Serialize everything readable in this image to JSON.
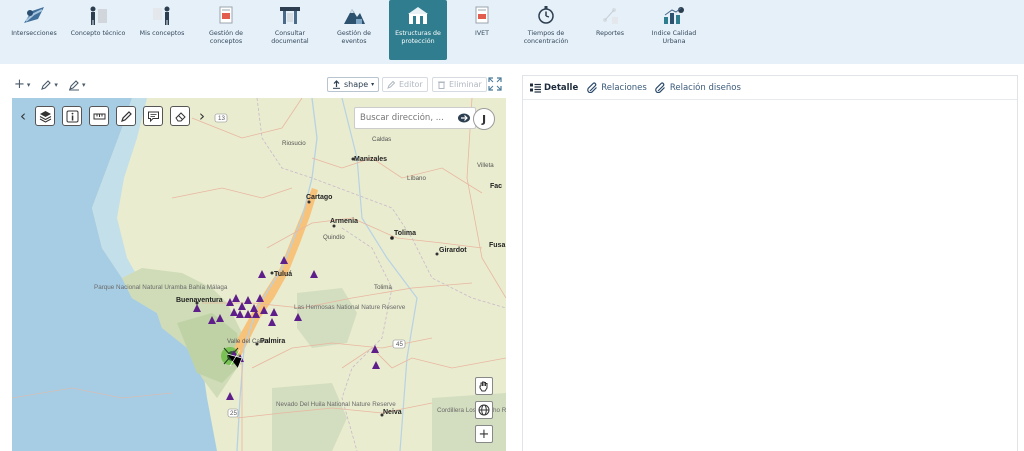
{
  "nav": {
    "items": [
      {
        "label": "Intersecciones",
        "icon": "intersections-icon"
      },
      {
        "label": "Concepto técnico",
        "icon": "technical-concept-icon"
      },
      {
        "label": "Mis conceptos",
        "icon": "my-concepts-icon"
      },
      {
        "label": "Gestión de conceptos",
        "icon": "concept-management-icon"
      },
      {
        "label": "Consultar documental",
        "icon": "document-query-icon"
      },
      {
        "label": "Gestión de eventos",
        "icon": "event-management-icon"
      },
      {
        "label": "Estructuras de protección",
        "icon": "protection-structures-icon",
        "active": true
      },
      {
        "label": "IVET",
        "icon": "ivet-icon"
      },
      {
        "label": "Tiempos de concentración",
        "icon": "stopwatch-icon"
      },
      {
        "label": "Reportes",
        "icon": "reports-icon"
      },
      {
        "label": "Indice Calidad Urbana",
        "icon": "urban-quality-icon"
      }
    ],
    "active_color": "#2f7d8e",
    "bar_color": "#e6f0f8"
  },
  "toolbar": {
    "shape_label": "shape",
    "editor_label": "Editor",
    "delete_label": "Eliminar"
  },
  "map": {
    "search_placeholder": "Buscar dirección, ...",
    "user_initial": "J",
    "zoom_in": "+",
    "labels": {
      "riosucio": "Riosucio",
      "caldas": "Caldas",
      "manizales": "Manizales",
      "villeta": "Villeta",
      "libano": "Líbano",
      "fac": "Fac",
      "cartago": "Cartago",
      "armenia": "Armenia",
      "quindio": "Quindío",
      "tolima_city": "Tolima",
      "girardot": "Girardot",
      "fusa": "Fusa",
      "tulua": "Tuluá",
      "tolima_region": "Tolima",
      "parque_uramba": "Parque Nacional Natural Uramba Bahía Málaga",
      "buenaventura": "Buenaventura",
      "las_hermosas": "Las Hermosas National Nature Reserve",
      "valle_del_cauca": "Valle del Cauca",
      "palmira": "Palmira",
      "huila_reserve": "Nevado Del Huila National Nature Reserve",
      "neiva": "Neiva",
      "cordillera": "Cordillera Los Picacho Reserve",
      "road_13": "13",
      "road_45": "45",
      "road_25": "25"
    }
  },
  "panel": {
    "tabs": [
      {
        "label": "Detalle",
        "active": true
      },
      {
        "label": "Relaciones"
      },
      {
        "label": "Relación diseños"
      }
    ]
  }
}
